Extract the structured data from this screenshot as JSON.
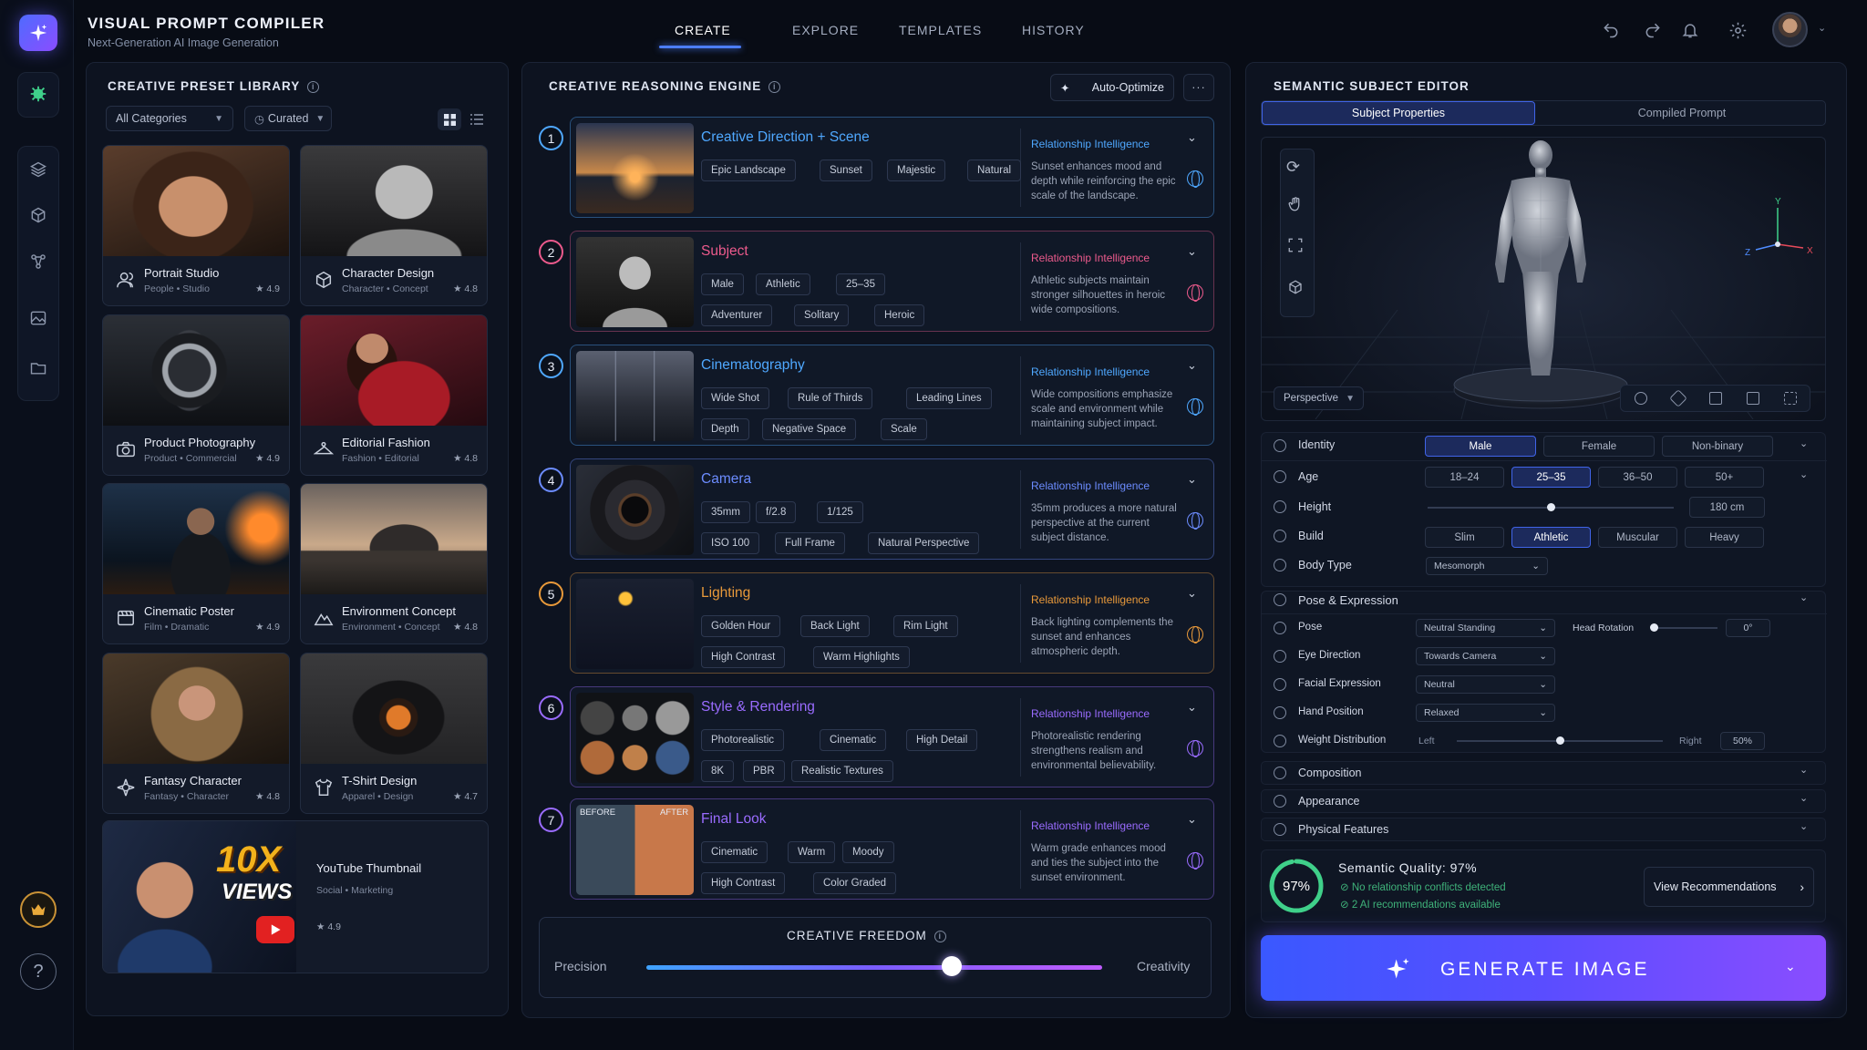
{
  "app": {
    "title": "VISUAL PROMPT COMPILER",
    "subtitle": "Next-Generation AI Image Generation"
  },
  "tabs": [
    {
      "label": "CREATE"
    },
    {
      "label": "EXPLORE"
    },
    {
      "label": "TEMPLATES"
    },
    {
      "label": "HISTORY"
    }
  ],
  "active_tab": "CREATE",
  "colors": {
    "accent": "#4c7dff",
    "purple": "#8a4dff",
    "gold": "#e8a93a"
  },
  "preset_library": {
    "title": "CREATIVE PRESET LIBRARY",
    "category_filter": "All Categories",
    "sort_filter": "Curated",
    "presets": [
      {
        "name": "Portrait Studio",
        "meta": "People • Studio",
        "rating": "★ 4.9",
        "icon": "person-icon"
      },
      {
        "name": "Character Design",
        "meta": "Character • Concept",
        "rating": "★ 4.8",
        "icon": "cube-icon"
      },
      {
        "name": "Product Photography",
        "meta": "Product • Commercial",
        "rating": "★ 4.9",
        "icon": "camera-icon"
      },
      {
        "name": "Editorial Fashion",
        "meta": "Fashion • Editorial",
        "rating": "★ 4.8",
        "icon": "hanger-icon"
      },
      {
        "name": "Cinematic Poster",
        "meta": "Film • Dramatic",
        "rating": "★ 4.9",
        "icon": "film-icon"
      },
      {
        "name": "Environment Concept",
        "meta": "Environment • Concept",
        "rating": "★ 4.8",
        "icon": "mountain-icon"
      },
      {
        "name": "Fantasy Character",
        "meta": "Fantasy • Character",
        "rating": "★ 4.8",
        "icon": "emblem-icon"
      },
      {
        "name": "T-Shirt Design",
        "meta": "Apparel • Design",
        "rating": "★ 4.7",
        "icon": "shirt-icon"
      }
    ],
    "featured": {
      "name": "YouTube Thumbnail",
      "meta": "Social • Marketing",
      "rating": "★ 4.9",
      "art_text": "10X",
      "art_text2": "VIEWS"
    }
  },
  "reasoning": {
    "title": "CREATIVE REASONING ENGINE",
    "auto_optimize": "Auto-Optimize",
    "relationship_label": "Relationship Intelligence",
    "steps": [
      {
        "num": "1",
        "title": "Creative Direction + Scene",
        "color": "#4fa8ff",
        "chips": [
          "Epic Landscape",
          "Sunset",
          "Majestic",
          "Natural"
        ],
        "relationship": "Sunset enhances mood and depth while reinforcing the epic scale of the landscape."
      },
      {
        "num": "2",
        "title": "Subject",
        "color": "#ec5a8c",
        "chips": [
          "Male",
          "Athletic",
          "25–35",
          "Adventurer",
          "Solitary",
          "Heroic"
        ],
        "relationship": "Athletic subjects maintain stronger silhouettes in heroic wide compositions."
      },
      {
        "num": "3",
        "title": "Cinematography",
        "color": "#4fa8ff",
        "chips": [
          "Wide Shot",
          "Rule of Thirds",
          "Leading Lines",
          "Depth",
          "Negative Space",
          "Scale"
        ],
        "relationship": "Wide compositions emphasize scale and environment while maintaining subject impact."
      },
      {
        "num": "4",
        "title": "Camera",
        "color": "#6c8cff",
        "chips": [
          "35mm",
          "f/2.8",
          "1/125",
          "ISO 100",
          "Full Frame",
          "Natural Perspective"
        ],
        "relationship": "35mm produces a more natural perspective at the current subject distance."
      },
      {
        "num": "5",
        "title": "Lighting",
        "color": "#e8993a",
        "chips": [
          "Golden Hour",
          "Back Light",
          "Rim Light",
          "High Contrast",
          "Warm Highlights"
        ],
        "relationship": "Back lighting complements the sunset and enhances atmospheric depth."
      },
      {
        "num": "6",
        "title": "Style & Rendering",
        "color": "#9a6cff",
        "chips": [
          "Photorealistic",
          "Cinematic",
          "High Detail",
          "8K",
          "PBR",
          "Realistic Textures"
        ],
        "relationship": "Photorealistic rendering strengthens realism and environmental believability."
      },
      {
        "num": "7",
        "title": "Final Look",
        "color": "#9a6cff",
        "chips": [
          "Cinematic",
          "Warm",
          "Moody",
          "High Contrast",
          "Color Graded"
        ],
        "relationship": "Warm grade enhances mood and ties the subject into the sunset environment.",
        "before": "BEFORE",
        "after": "AFTER"
      }
    ],
    "freedom": {
      "title": "CREATIVE FREEDOM",
      "left": "Precision",
      "right": "Creativity",
      "value": 0.67
    }
  },
  "editor": {
    "title": "SEMANTIC SUBJECT EDITOR",
    "tabs": [
      "Subject Properties",
      "Compiled Prompt"
    ],
    "view_mode": "Perspective",
    "axes": {
      "x": "X",
      "y": "Y",
      "z": "Z"
    },
    "identity": {
      "label": "Identity",
      "options": [
        "Male",
        "Female",
        "Non-binary"
      ],
      "selected": "Male"
    },
    "age": {
      "label": "Age",
      "options": [
        "18–24",
        "25–35",
        "36–50",
        "50+"
      ],
      "selected": "25–35"
    },
    "height": {
      "label": "Height",
      "value": "180 cm",
      "level": 0.5
    },
    "build": {
      "label": "Build",
      "options": [
        "Slim",
        "Athletic",
        "Muscular",
        "Heavy"
      ],
      "selected": "Athletic"
    },
    "body_type": {
      "label": "Body Type",
      "value": "Mesomorph"
    },
    "pose_section": "Pose & Expression",
    "pose": {
      "label": "Pose",
      "value": "Neutral Standing"
    },
    "head_rotation": {
      "label": "Head Rotation",
      "value": "0°",
      "level": 0.0
    },
    "eye_direction": {
      "label": "Eye Direction",
      "value": "Towards Camera"
    },
    "facial_expression": {
      "label": "Facial Expression",
      "value": "Neutral"
    },
    "hand_position": {
      "label": "Hand Position",
      "value": "Relaxed"
    },
    "weight_distribution": {
      "label": "Weight Distribution",
      "left": "Left",
      "right": "Right",
      "value": "50%",
      "level": 0.5
    },
    "collapsed_sections": [
      "Composition",
      "Appearance",
      "Physical Features"
    ],
    "quality": {
      "percent": "97%",
      "level": 0.97,
      "title": "Semantic Quality: 97%",
      "line1": "No relationship conflicts detected",
      "line2": "2 AI recommendations available",
      "button": "View Recommendations"
    },
    "generate_label": "GENERATE IMAGE"
  }
}
